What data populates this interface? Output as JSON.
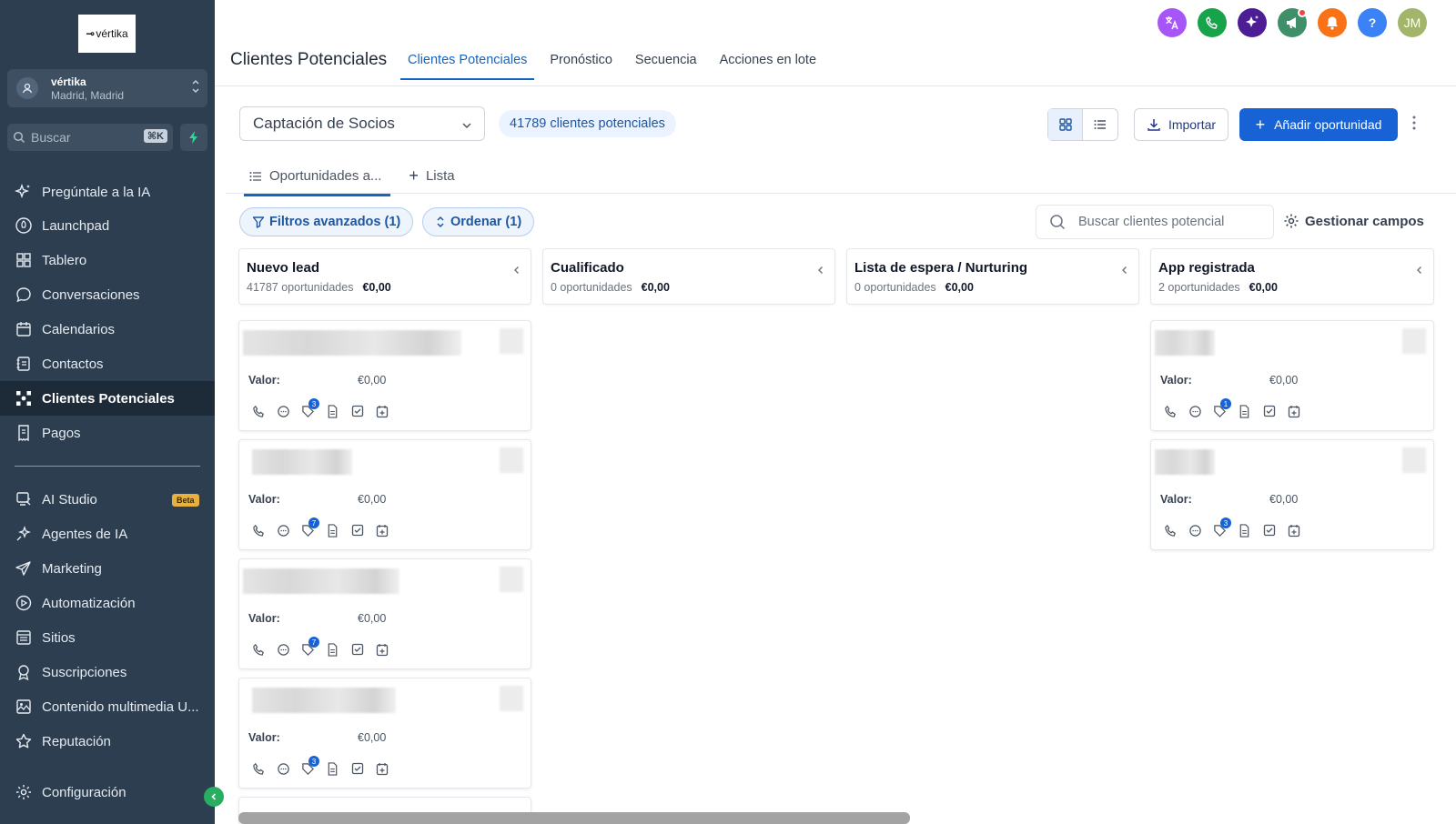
{
  "sidebar": {
    "logo_mark": "⊸",
    "logo_text": "vértika",
    "account_name": "vértika",
    "account_location": "Madrid, Madrid",
    "search_placeholder": "Buscar",
    "search_shortcut": "⌘K",
    "items": [
      {
        "label": "Pregúntale a la IA",
        "icon": "sparkle-icon"
      },
      {
        "label": "Launchpad",
        "icon": "rocket-icon"
      },
      {
        "label": "Tablero",
        "icon": "dashboard-icon"
      },
      {
        "label": "Conversaciones",
        "icon": "chat-icon"
      },
      {
        "label": "Calendarios",
        "icon": "calendar-icon"
      },
      {
        "label": "Contactos",
        "icon": "contacts-icon"
      },
      {
        "label": "Clientes Potenciales",
        "icon": "opportunities-icon",
        "active": true
      },
      {
        "label": "Pagos",
        "icon": "receipt-icon"
      },
      {
        "label": "AI Studio",
        "icon": "ai-studio-icon",
        "badge": "Beta"
      },
      {
        "label": "Agentes de IA",
        "icon": "agent-sparkle-icon"
      },
      {
        "label": "Marketing",
        "icon": "send-icon"
      },
      {
        "label": "Automatización",
        "icon": "automation-icon"
      },
      {
        "label": "Sitios",
        "icon": "sites-icon"
      },
      {
        "label": "Suscripciones",
        "icon": "award-icon"
      },
      {
        "label": "Contenido multimedia U...",
        "icon": "media-icon"
      },
      {
        "label": "Reputación",
        "icon": "star-icon"
      },
      {
        "label": "Configuración",
        "icon": "gear-icon"
      }
    ]
  },
  "header": {
    "title": "Clientes Potenciales",
    "tabs": [
      {
        "label": "Clientes Potenciales",
        "active": true
      },
      {
        "label": "Pronóstico"
      },
      {
        "label": "Secuencia"
      },
      {
        "label": "Acciones en lote"
      }
    ],
    "top_icons": [
      {
        "name": "translate-icon",
        "color": "#a855f7"
      },
      {
        "name": "phone-icon",
        "color": "#16a34a"
      },
      {
        "name": "ai-sparkle-icon",
        "color": "#4c1d95"
      },
      {
        "name": "megaphone-icon",
        "color": "#3f8f6a",
        "notification": true
      },
      {
        "name": "bell-icon",
        "color": "#f97316"
      },
      {
        "name": "help-icon",
        "color": "#3b82f6",
        "text": "?"
      },
      {
        "name": "user-avatar",
        "color": "#a3b56b",
        "text": "JM"
      }
    ]
  },
  "toolbar": {
    "pipeline": "Captación de Socios",
    "count_label": "41789 clientes potenciales",
    "import_label": "Importar",
    "add_label": "Añadir oportunidad"
  },
  "subtabs": [
    {
      "label": "Oportunidades a...",
      "active": true
    },
    {
      "label": "Lista"
    }
  ],
  "filters": {
    "advanced": "Filtros avanzados (1)",
    "sort": "Ordenar (1)",
    "search_placeholder": "Buscar clientes potencial",
    "manage_fields": "Gestionar campos"
  },
  "colors": {
    "sidebar_bg": "#2c3e50",
    "accent": "#1763d6",
    "active_tab": "#1565c0"
  },
  "columns": [
    {
      "title": "Nuevo lead",
      "count": "41787 oportunidades",
      "amount": "€0,00",
      "cards": [
        {
          "value_label": "Valor:",
          "value": "€0,00",
          "tag_count": "3"
        },
        {
          "value_label": "Valor:",
          "value": "€0,00",
          "tag_count": "7"
        },
        {
          "value_label": "Valor:",
          "value": "€0,00",
          "tag_count": "7"
        },
        {
          "value_label": "Valor:",
          "value": "€0,00",
          "tag_count": "3"
        }
      ]
    },
    {
      "title": "Cualificado",
      "count": "0 oportunidades",
      "amount": "€0,00",
      "cards": []
    },
    {
      "title": "Lista de espera / Nurturing",
      "count": "0 oportunidades",
      "amount": "€0,00",
      "cards": []
    },
    {
      "title": "App registrada",
      "count": "2 oportunidades",
      "amount": "€0,00",
      "cards": [
        {
          "value_label": "Valor:",
          "value": "€0,00",
          "tag_count": "1"
        },
        {
          "value_label": "Valor:",
          "value": "€0,00",
          "tag_count": "3"
        }
      ]
    }
  ]
}
